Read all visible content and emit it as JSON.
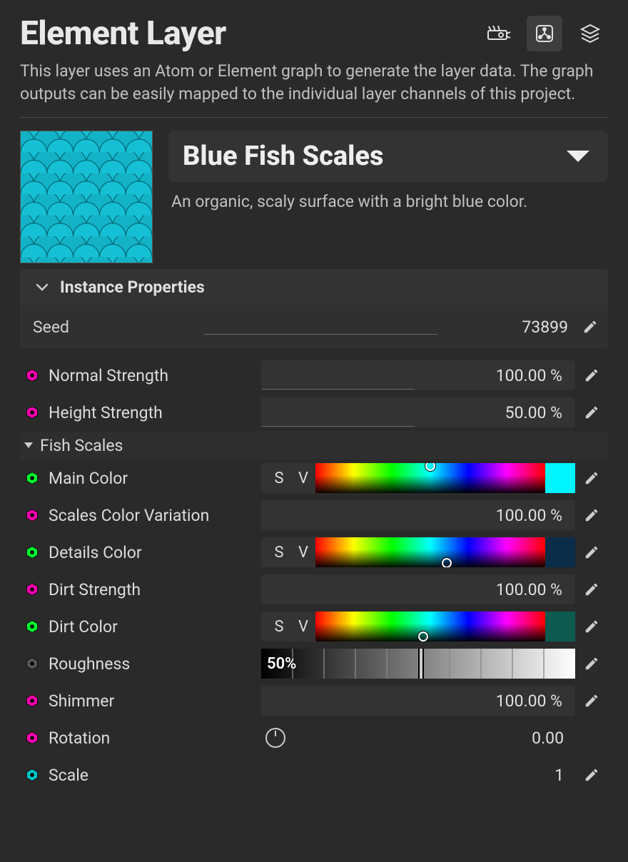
{
  "header": {
    "title": "Element Layer",
    "description": "This layer uses an Atom or Element graph to generate the layer data. The graph outputs can be easily mapped to the individual layer channels of this project."
  },
  "preset": {
    "name": "Blue Fish Scales",
    "description": "An organic, scaly surface with a bright blue color."
  },
  "section": {
    "title": "Instance Properties",
    "seed_label": "Seed",
    "seed_value": "73899"
  },
  "params": {
    "normal_strength": {
      "label": "Normal Strength",
      "value": "100.00 %",
      "color": "#ff00b0"
    },
    "height_strength": {
      "label": "Height Strength",
      "value": "50.00 %",
      "color": "#ff00b0"
    },
    "group_label": "Fish Scales",
    "main_color": {
      "label": "Main Color",
      "swatch": "#00f5ff",
      "node": "#00ff30",
      "hx": 0.5,
      "hy": 0.05
    },
    "scales_variation": {
      "label": "Scales Color Variation",
      "value": "100.00 %",
      "color": "#ff00b0"
    },
    "details_color": {
      "label": "Details Color",
      "swatch": "#0a2d4a",
      "node": "#00ff30",
      "hx": 0.57,
      "hy": 0.85
    },
    "dirt_strength": {
      "label": "Dirt Strength",
      "value": "100.00 %",
      "color": "#ff00b0"
    },
    "dirt_color": {
      "label": "Dirt Color",
      "swatch": "#0d5a4f",
      "node": "#00ff30",
      "hx": 0.47,
      "hy": 0.82
    },
    "roughness": {
      "label": "Roughness",
      "value": "50%",
      "node": "#555",
      "pos": 0.5
    },
    "shimmer": {
      "label": "Shimmer",
      "value": "100.00 %",
      "color": "#ff00b0"
    },
    "rotation": {
      "label": "Rotation",
      "value": "0.00",
      "color": "#ff00b0"
    },
    "scale": {
      "label": "Scale",
      "value": "1",
      "color": "#00c5c5"
    }
  },
  "sv": {
    "s": "S",
    "v": "V"
  }
}
